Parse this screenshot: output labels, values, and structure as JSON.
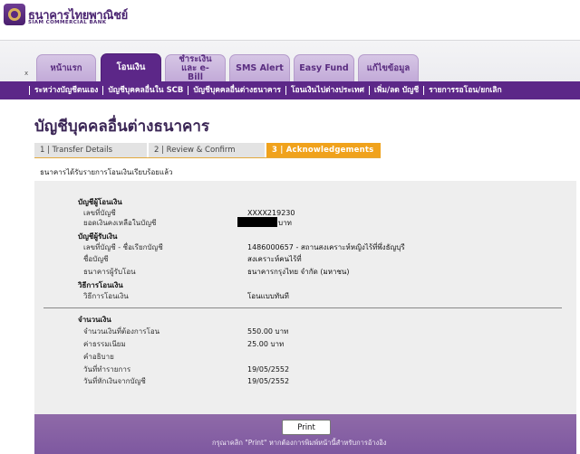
{
  "bank": {
    "name_th": "ธนาคารไทยพาณิชย์",
    "name_en": "SIAM COMMERCIAL BANK"
  },
  "tabs": {
    "close_mark": "x",
    "items": [
      {
        "label": "หน้าแรก"
      },
      {
        "label": "โอนเงิน"
      },
      {
        "label": "ชำระเงิน และ e-Bill"
      },
      {
        "label": "SMS Alert"
      },
      {
        "label": "Easy Fund"
      },
      {
        "label": "แก้ไขข้อมูล"
      }
    ]
  },
  "menu": {
    "items": [
      {
        "label": "ระหว่างบัญชีตนเอง"
      },
      {
        "label": "บัญชีบุคคลอื่นใน SCB"
      },
      {
        "label": "บัญชีบุคคลอื่นต่างธนาคาร"
      },
      {
        "label": "โอนเงินไปต่างประเทศ"
      },
      {
        "label": "เพิ่ม/ลด บัญชี"
      },
      {
        "label": "รายการรอโอน/ยกเลิก"
      }
    ]
  },
  "page": {
    "title": "บัญชีบุคคลอื่นต่างธนาคาร",
    "steps": [
      {
        "label": "1 | Transfer Details"
      },
      {
        "label": "2 | Review & Confirm"
      },
      {
        "label": "3 | Acknowledgements"
      }
    ],
    "success_message": "ธนาคารได้รับรายการโอนเงินเรียบร้อยแล้ว"
  },
  "details": {
    "from_section": "บัญชีผู้โอนเงิน",
    "from_account_label": "เลขที่บัญชี",
    "from_account_value": "XXXX219230",
    "balance_label": "ยอดเงินคงเหลือในบัญชี",
    "balance_unit": "บาท",
    "to_section": "บัญชีผู้รับเงิน",
    "to_account_label": "เลขที่บัญชี - ชื่อเรียกบัญชี",
    "to_account_value": "1486000657 - สถานสงเคราะห์หญิงไร้ที่พึ่งธัญบุรี",
    "to_name_label": "ชื่อบัญชี",
    "to_name_value": "สงเคราะห์คนไร้ที่",
    "to_bank_label": "ธนาคารผู้รับโอน",
    "to_bank_value": "ธนาคารกรุงไทย จำกัด (มหาชน)",
    "method_section": "วิธีการโอนเงิน",
    "method_label": "วิธีการโอนเงิน",
    "method_value": "โอนแบบทันที",
    "amount_section": "จำนวนเงิน",
    "amount_label": "จำนวนเงินที่ต้องการโอน",
    "amount_value": "550.00 บาท",
    "fee_label": "ค่าธรรมเนียม",
    "fee_value": "25.00 บาท",
    "desc_label": "คำอธิบาย",
    "txn_date_label": "วันที่ทำรายการ",
    "txn_date_value": "19/05/2552",
    "debit_date_label": "วันที่หักเงินจากบัญชี",
    "debit_date_value": "19/05/2552"
  },
  "print": {
    "button_label": "Print",
    "hint": "กรุณาคลิก \"Print\" หากต้องการพิมพ์หน้านี้สำหรับการอ้างอิง"
  },
  "colors": {
    "brand_purple": "#5c2788",
    "active_step": "#f0a21c",
    "light_tab": "#c9b3dd",
    "print_band": "#866099"
  }
}
